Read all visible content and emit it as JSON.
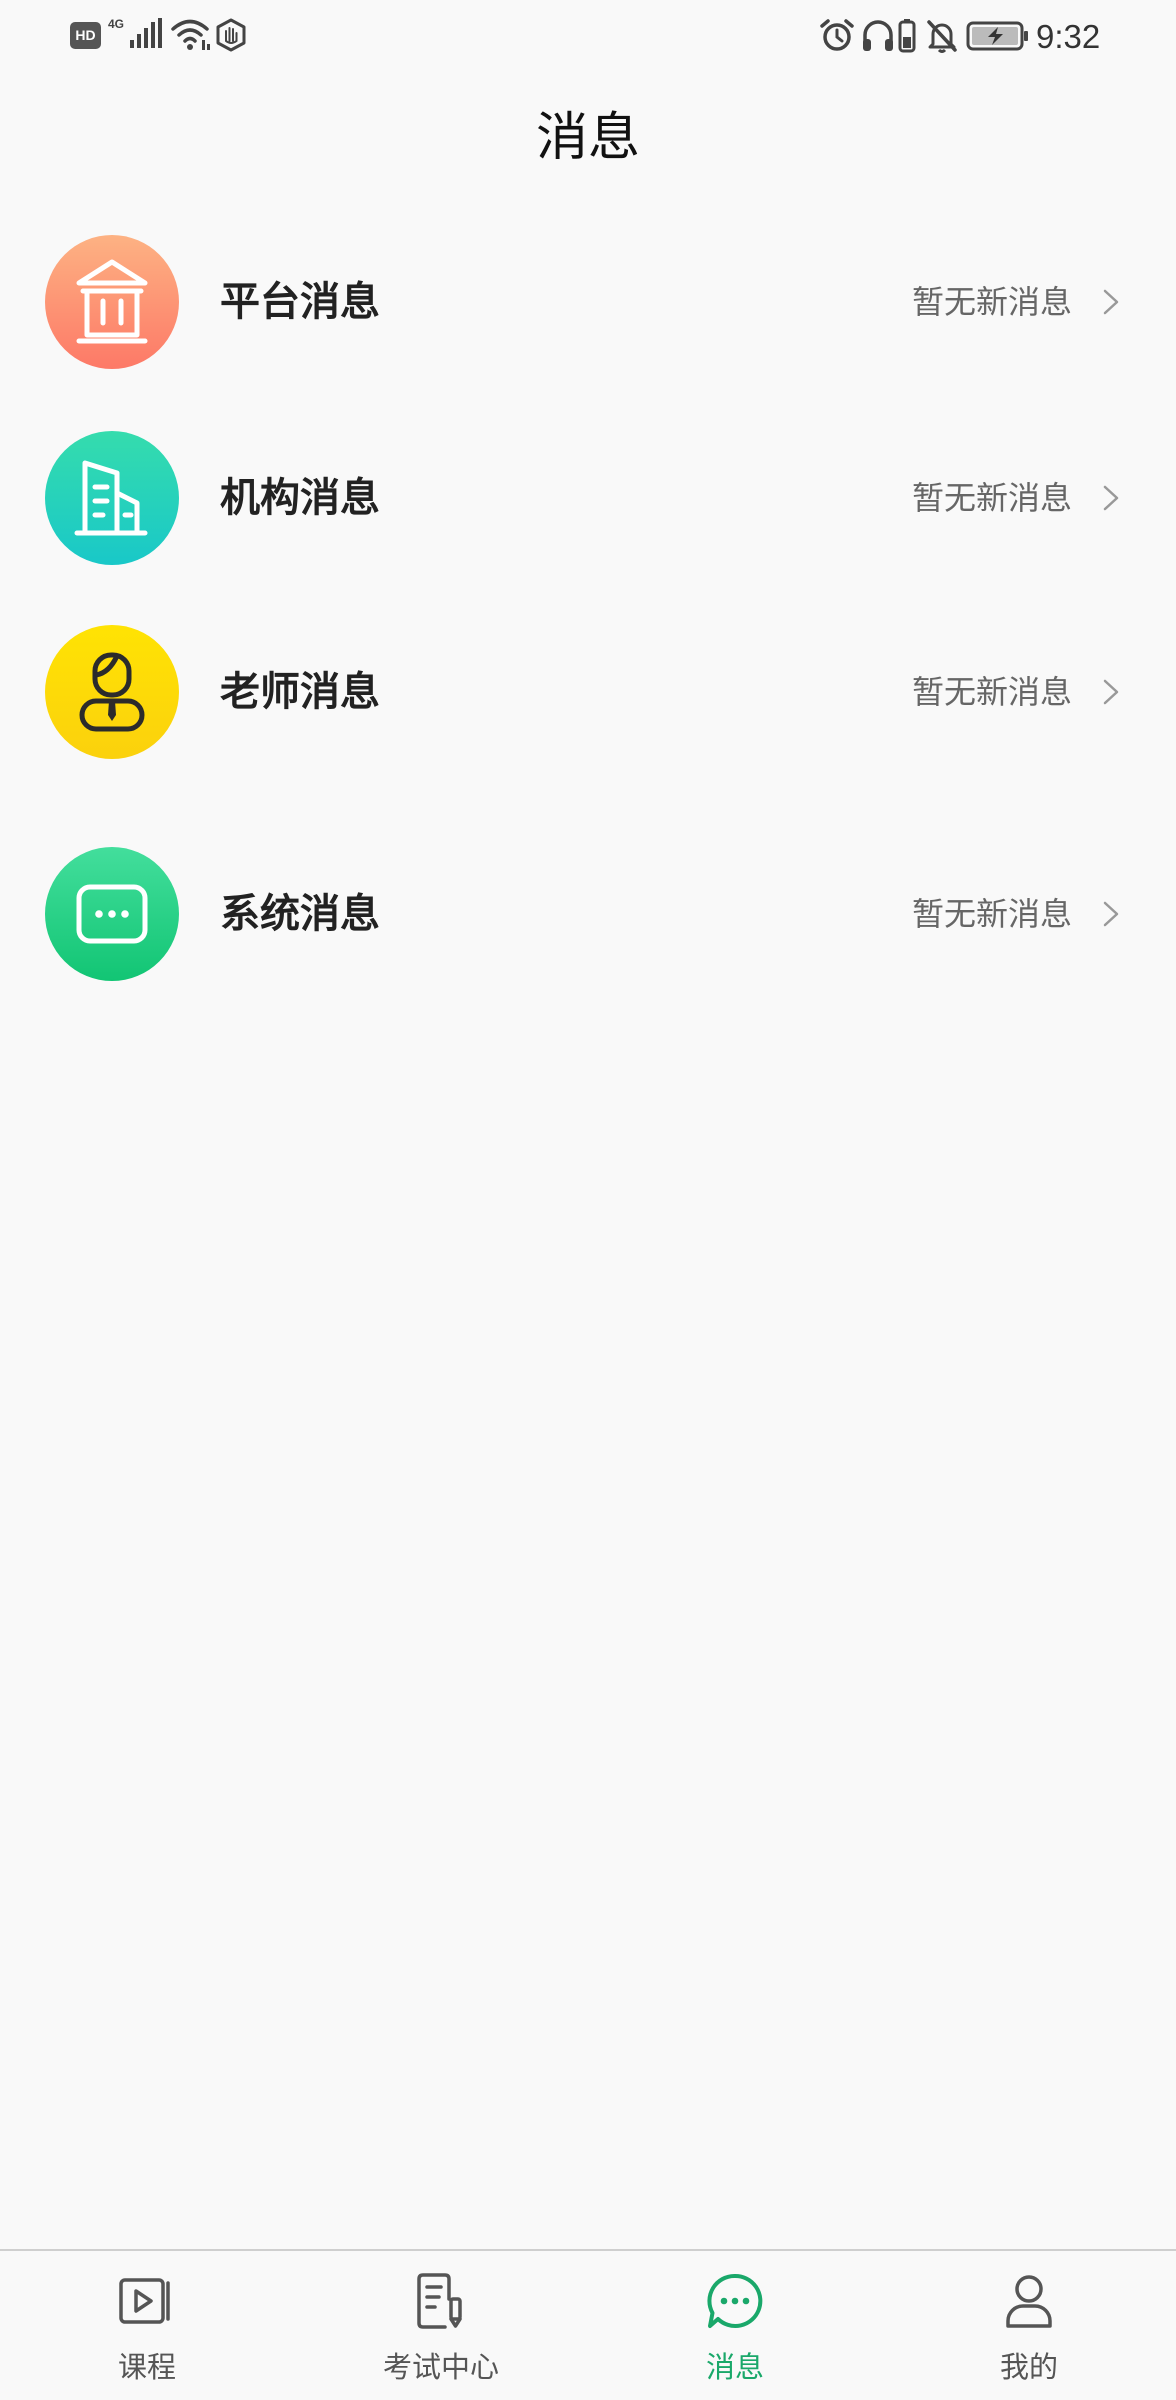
{
  "status_bar": {
    "hd_label": "HD",
    "network_label": "4G",
    "time": "9:32",
    "icons_left": [
      "hd-icon",
      "signal-icon",
      "wifi-icon",
      "hexagon-hand-icon"
    ],
    "icons_right": [
      "alarm-icon",
      "headphones-icon",
      "device-battery-icon",
      "bell-muted-icon",
      "battery-charging-icon"
    ]
  },
  "header": {
    "title": "消息"
  },
  "messages": {
    "items": [
      {
        "label": "平台消息",
        "status": "暂无新消息",
        "icon": "bank-icon",
        "gradient": [
          "#fdb283",
          "#fd7967"
        ]
      },
      {
        "label": "机构消息",
        "status": "暂无新消息",
        "icon": "building-icon",
        "gradient": [
          "#35dcad",
          "#19c8c8"
        ]
      },
      {
        "label": "老师消息",
        "status": "暂无新消息",
        "icon": "teacher-icon",
        "gradient": [
          "#ffe303",
          "#fbd10d"
        ]
      },
      {
        "label": "系统消息",
        "status": "暂无新消息",
        "icon": "chat-dots-icon",
        "gradient": [
          "#43de9c",
          "#12c574"
        ]
      }
    ]
  },
  "tab_bar": {
    "active_color": "#1aa86a",
    "inactive_color": "#555555",
    "items": [
      {
        "label": "课程",
        "icon": "video-play-icon",
        "active": false
      },
      {
        "label": "考试中心",
        "icon": "exam-document-icon",
        "active": false
      },
      {
        "label": "消息",
        "icon": "chat-bubble-icon",
        "active": true
      },
      {
        "label": "我的",
        "icon": "person-icon",
        "active": false
      }
    ]
  }
}
